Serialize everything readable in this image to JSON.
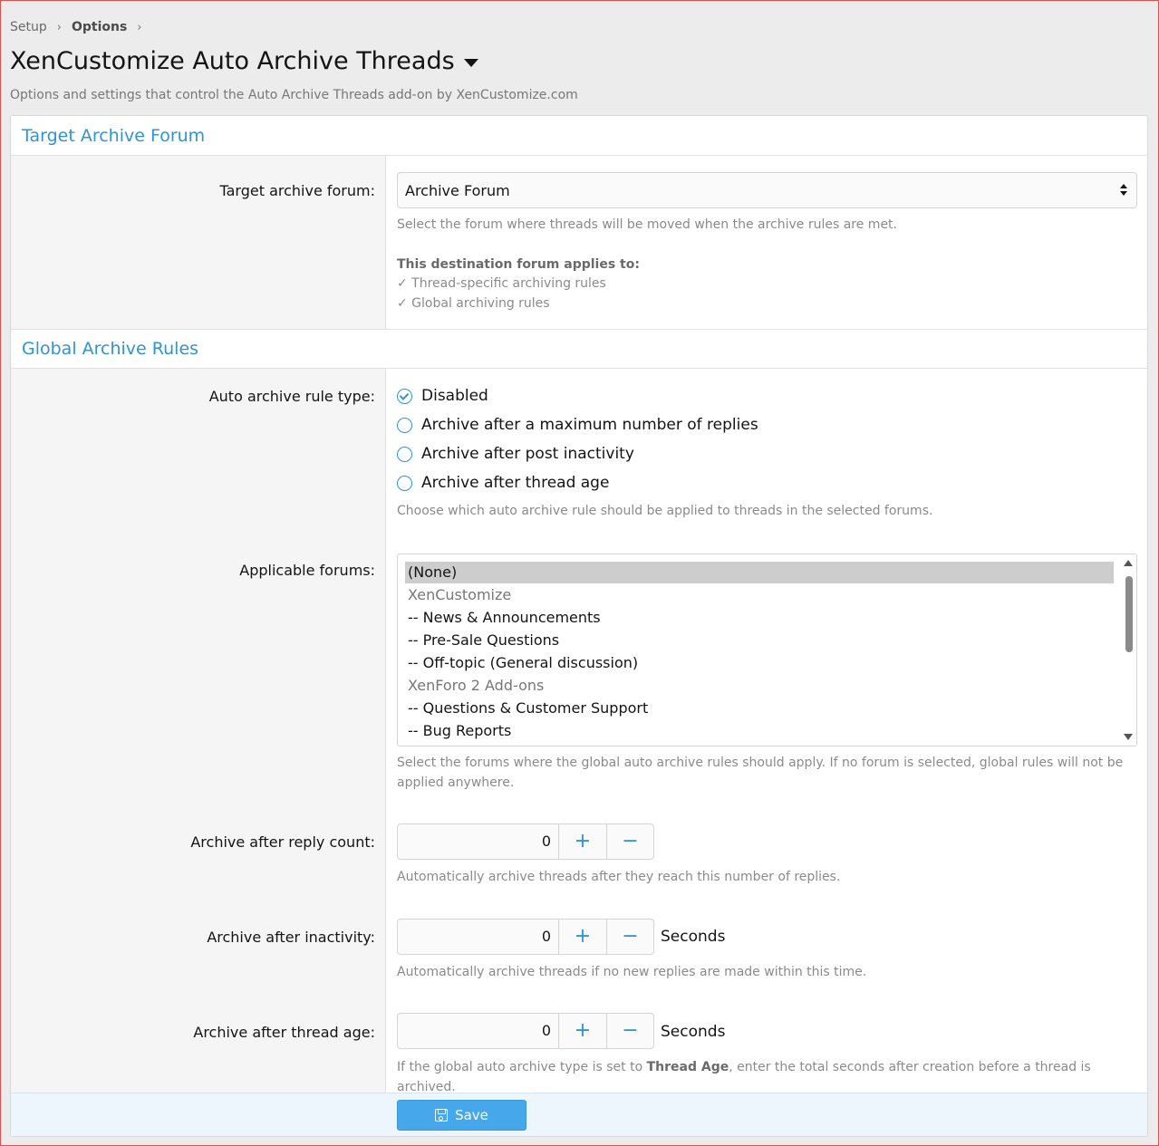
{
  "breadcrumb": {
    "items": [
      "Setup",
      "Options"
    ]
  },
  "header": {
    "title": "XenCustomize Auto Archive Threads",
    "description": "Options and settings that control the Auto Archive Threads add-on by XenCustomize.com"
  },
  "sections": {
    "target": {
      "title": "Target Archive Forum",
      "forum_label": "Target archive forum:",
      "forum_value": "Archive Forum",
      "forum_hint": "Select the forum where threads will be moved when the archive rules are met.",
      "applies_heading": "This destination forum applies to:",
      "applies_items": [
        "✓ Thread-specific archiving rules",
        "✓ Global archiving rules"
      ]
    },
    "global": {
      "title": "Global Archive Rules",
      "rule_type_label": "Auto archive rule type:",
      "rule_options": [
        {
          "label": "Disabled",
          "checked": true
        },
        {
          "label": "Archive after a maximum number of replies",
          "checked": false
        },
        {
          "label": "Archive after post inactivity",
          "checked": false
        },
        {
          "label": "Archive after thread age",
          "checked": false
        }
      ],
      "rule_type_hint": "Choose which auto archive rule should be applied to threads in the selected forums.",
      "forums_label": "Applicable forums:",
      "forums": [
        {
          "label": "(None)",
          "kind": "selected"
        },
        {
          "label": "XenCustomize",
          "kind": "group"
        },
        {
          "label": "-- News & Announcements",
          "kind": "item"
        },
        {
          "label": "-- Pre-Sale Questions",
          "kind": "item"
        },
        {
          "label": "-- Off-topic (General discussion)",
          "kind": "item"
        },
        {
          "label": "XenForo 2 Add-ons",
          "kind": "group"
        },
        {
          "label": "-- Questions & Customer Support",
          "kind": "item"
        },
        {
          "label": "-- Bug Reports",
          "kind": "item"
        }
      ],
      "forums_hint_line1": "Select the forums where the global auto archive rules should apply. If no forum is selected, global rules will not be",
      "forums_hint_line2": "applied anywhere.",
      "reply_count_label": "Archive after reply count:",
      "reply_count_value": "0",
      "reply_count_hint": "Automatically archive threads after they reach this number of replies.",
      "inactivity_label": "Archive after inactivity:",
      "inactivity_value": "0",
      "inactivity_units": "Seconds",
      "inactivity_hint": "Automatically archive threads if no new replies are made within this time.",
      "thread_age_label": "Archive after thread age:",
      "thread_age_value": "0",
      "thread_age_units": "Seconds",
      "thread_age_hint_pre": "If the global auto archive type is set to ",
      "thread_age_hint_bold": "Thread Age",
      "thread_age_hint_post": ", enter the total seconds after creation before a thread is archived."
    }
  },
  "stepper": {
    "plus": "+",
    "minus": "−"
  },
  "footer": {
    "save_label": "Save"
  },
  "colors": {
    "accent": "#2f94d6",
    "save_button": "#47a7eb"
  }
}
